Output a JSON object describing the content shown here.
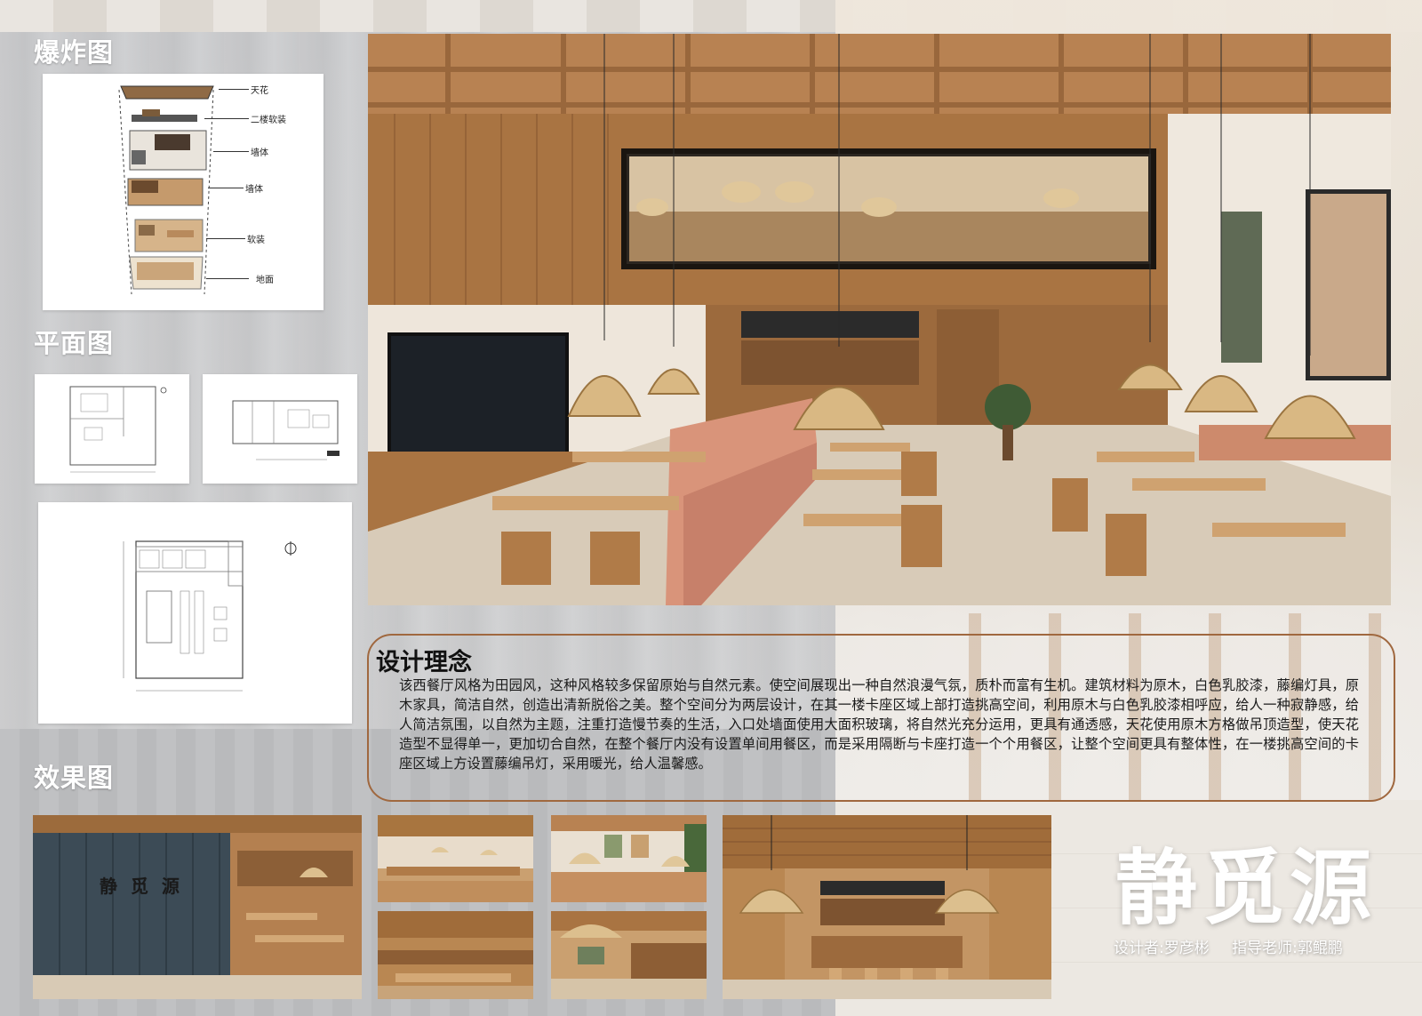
{
  "sections": {
    "explode_title": "爆炸图",
    "plan_title": "平面图",
    "render_title": "效果图"
  },
  "explode_labels": [
    "天花",
    "二楼软装",
    "墙体",
    "墙体",
    "软装",
    "地面"
  ],
  "concept": {
    "title": "设计理念",
    "body": "该西餐厅风格为田园风，这种风格较多保留原始与自然元素。使空间展现出一种自然浪漫气氛，质朴而富有生机。建筑材料为原木，白色乳胶漆，藤编灯具，原木家具，简洁自然，创造出清新脱俗之美。整个空间分为两层设计，在其一楼卡座区域上部打造挑高空间，利用原木与白色乳胶漆相呼应，给人一种寂静感，给人简洁氛围，以自然为主题，注重打造慢节奏的生活，入口处墙面使用大面积玻璃，将自然光充分运用，更具有通透感，天花使用原木方格做吊顶造型，使天花造型不显得单一，更加切合自然，在整个餐厅内没有设置单间用餐区，而是采用隔断与卡座打造一个个用餐区，让整个空间更具有整体性，在一楼挑高空间的卡座区域上方设置藤编吊灯，采用暖光，给人温馨感。"
  },
  "brand": {
    "name": "静觅源",
    "designer": "设计者:罗彦彬",
    "advisor": "指导老师:郭鲲鹏",
    "sign_text": "静 觅 源"
  },
  "colors": {
    "wood": "#b98752",
    "wood_dark": "#8a5a32",
    "cushion": "#d9947a",
    "wall_white": "#efe8de",
    "accent_border": "#a0683f"
  }
}
